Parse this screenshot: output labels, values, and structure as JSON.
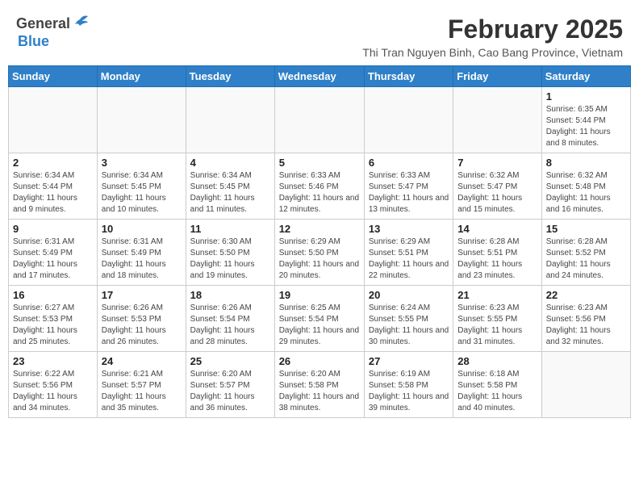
{
  "header": {
    "logo_general": "General",
    "logo_blue": "Blue",
    "title": "February 2025",
    "subtitle": "Thi Tran Nguyen Binh, Cao Bang Province, Vietnam"
  },
  "weekdays": [
    "Sunday",
    "Monday",
    "Tuesday",
    "Wednesday",
    "Thursday",
    "Friday",
    "Saturday"
  ],
  "weeks": [
    [
      {
        "day": "",
        "info": ""
      },
      {
        "day": "",
        "info": ""
      },
      {
        "day": "",
        "info": ""
      },
      {
        "day": "",
        "info": ""
      },
      {
        "day": "",
        "info": ""
      },
      {
        "day": "",
        "info": ""
      },
      {
        "day": "1",
        "info": "Sunrise: 6:35 AM\nSunset: 5:44 PM\nDaylight: 11 hours and 8 minutes."
      }
    ],
    [
      {
        "day": "2",
        "info": "Sunrise: 6:34 AM\nSunset: 5:44 PM\nDaylight: 11 hours and 9 minutes."
      },
      {
        "day": "3",
        "info": "Sunrise: 6:34 AM\nSunset: 5:45 PM\nDaylight: 11 hours and 10 minutes."
      },
      {
        "day": "4",
        "info": "Sunrise: 6:34 AM\nSunset: 5:45 PM\nDaylight: 11 hours and 11 minutes."
      },
      {
        "day": "5",
        "info": "Sunrise: 6:33 AM\nSunset: 5:46 PM\nDaylight: 11 hours and 12 minutes."
      },
      {
        "day": "6",
        "info": "Sunrise: 6:33 AM\nSunset: 5:47 PM\nDaylight: 11 hours and 13 minutes."
      },
      {
        "day": "7",
        "info": "Sunrise: 6:32 AM\nSunset: 5:47 PM\nDaylight: 11 hours and 15 minutes."
      },
      {
        "day": "8",
        "info": "Sunrise: 6:32 AM\nSunset: 5:48 PM\nDaylight: 11 hours and 16 minutes."
      }
    ],
    [
      {
        "day": "9",
        "info": "Sunrise: 6:31 AM\nSunset: 5:49 PM\nDaylight: 11 hours and 17 minutes."
      },
      {
        "day": "10",
        "info": "Sunrise: 6:31 AM\nSunset: 5:49 PM\nDaylight: 11 hours and 18 minutes."
      },
      {
        "day": "11",
        "info": "Sunrise: 6:30 AM\nSunset: 5:50 PM\nDaylight: 11 hours and 19 minutes."
      },
      {
        "day": "12",
        "info": "Sunrise: 6:29 AM\nSunset: 5:50 PM\nDaylight: 11 hours and 20 minutes."
      },
      {
        "day": "13",
        "info": "Sunrise: 6:29 AM\nSunset: 5:51 PM\nDaylight: 11 hours and 22 minutes."
      },
      {
        "day": "14",
        "info": "Sunrise: 6:28 AM\nSunset: 5:51 PM\nDaylight: 11 hours and 23 minutes."
      },
      {
        "day": "15",
        "info": "Sunrise: 6:28 AM\nSunset: 5:52 PM\nDaylight: 11 hours and 24 minutes."
      }
    ],
    [
      {
        "day": "16",
        "info": "Sunrise: 6:27 AM\nSunset: 5:53 PM\nDaylight: 11 hours and 25 minutes."
      },
      {
        "day": "17",
        "info": "Sunrise: 6:26 AM\nSunset: 5:53 PM\nDaylight: 11 hours and 26 minutes."
      },
      {
        "day": "18",
        "info": "Sunrise: 6:26 AM\nSunset: 5:54 PM\nDaylight: 11 hours and 28 minutes."
      },
      {
        "day": "19",
        "info": "Sunrise: 6:25 AM\nSunset: 5:54 PM\nDaylight: 11 hours and 29 minutes."
      },
      {
        "day": "20",
        "info": "Sunrise: 6:24 AM\nSunset: 5:55 PM\nDaylight: 11 hours and 30 minutes."
      },
      {
        "day": "21",
        "info": "Sunrise: 6:23 AM\nSunset: 5:55 PM\nDaylight: 11 hours and 31 minutes."
      },
      {
        "day": "22",
        "info": "Sunrise: 6:23 AM\nSunset: 5:56 PM\nDaylight: 11 hours and 32 minutes."
      }
    ],
    [
      {
        "day": "23",
        "info": "Sunrise: 6:22 AM\nSunset: 5:56 PM\nDaylight: 11 hours and 34 minutes."
      },
      {
        "day": "24",
        "info": "Sunrise: 6:21 AM\nSunset: 5:57 PM\nDaylight: 11 hours and 35 minutes."
      },
      {
        "day": "25",
        "info": "Sunrise: 6:20 AM\nSunset: 5:57 PM\nDaylight: 11 hours and 36 minutes."
      },
      {
        "day": "26",
        "info": "Sunrise: 6:20 AM\nSunset: 5:58 PM\nDaylight: 11 hours and 38 minutes."
      },
      {
        "day": "27",
        "info": "Sunrise: 6:19 AM\nSunset: 5:58 PM\nDaylight: 11 hours and 39 minutes."
      },
      {
        "day": "28",
        "info": "Sunrise: 6:18 AM\nSunset: 5:58 PM\nDaylight: 11 hours and 40 minutes."
      },
      {
        "day": "",
        "info": ""
      }
    ]
  ]
}
